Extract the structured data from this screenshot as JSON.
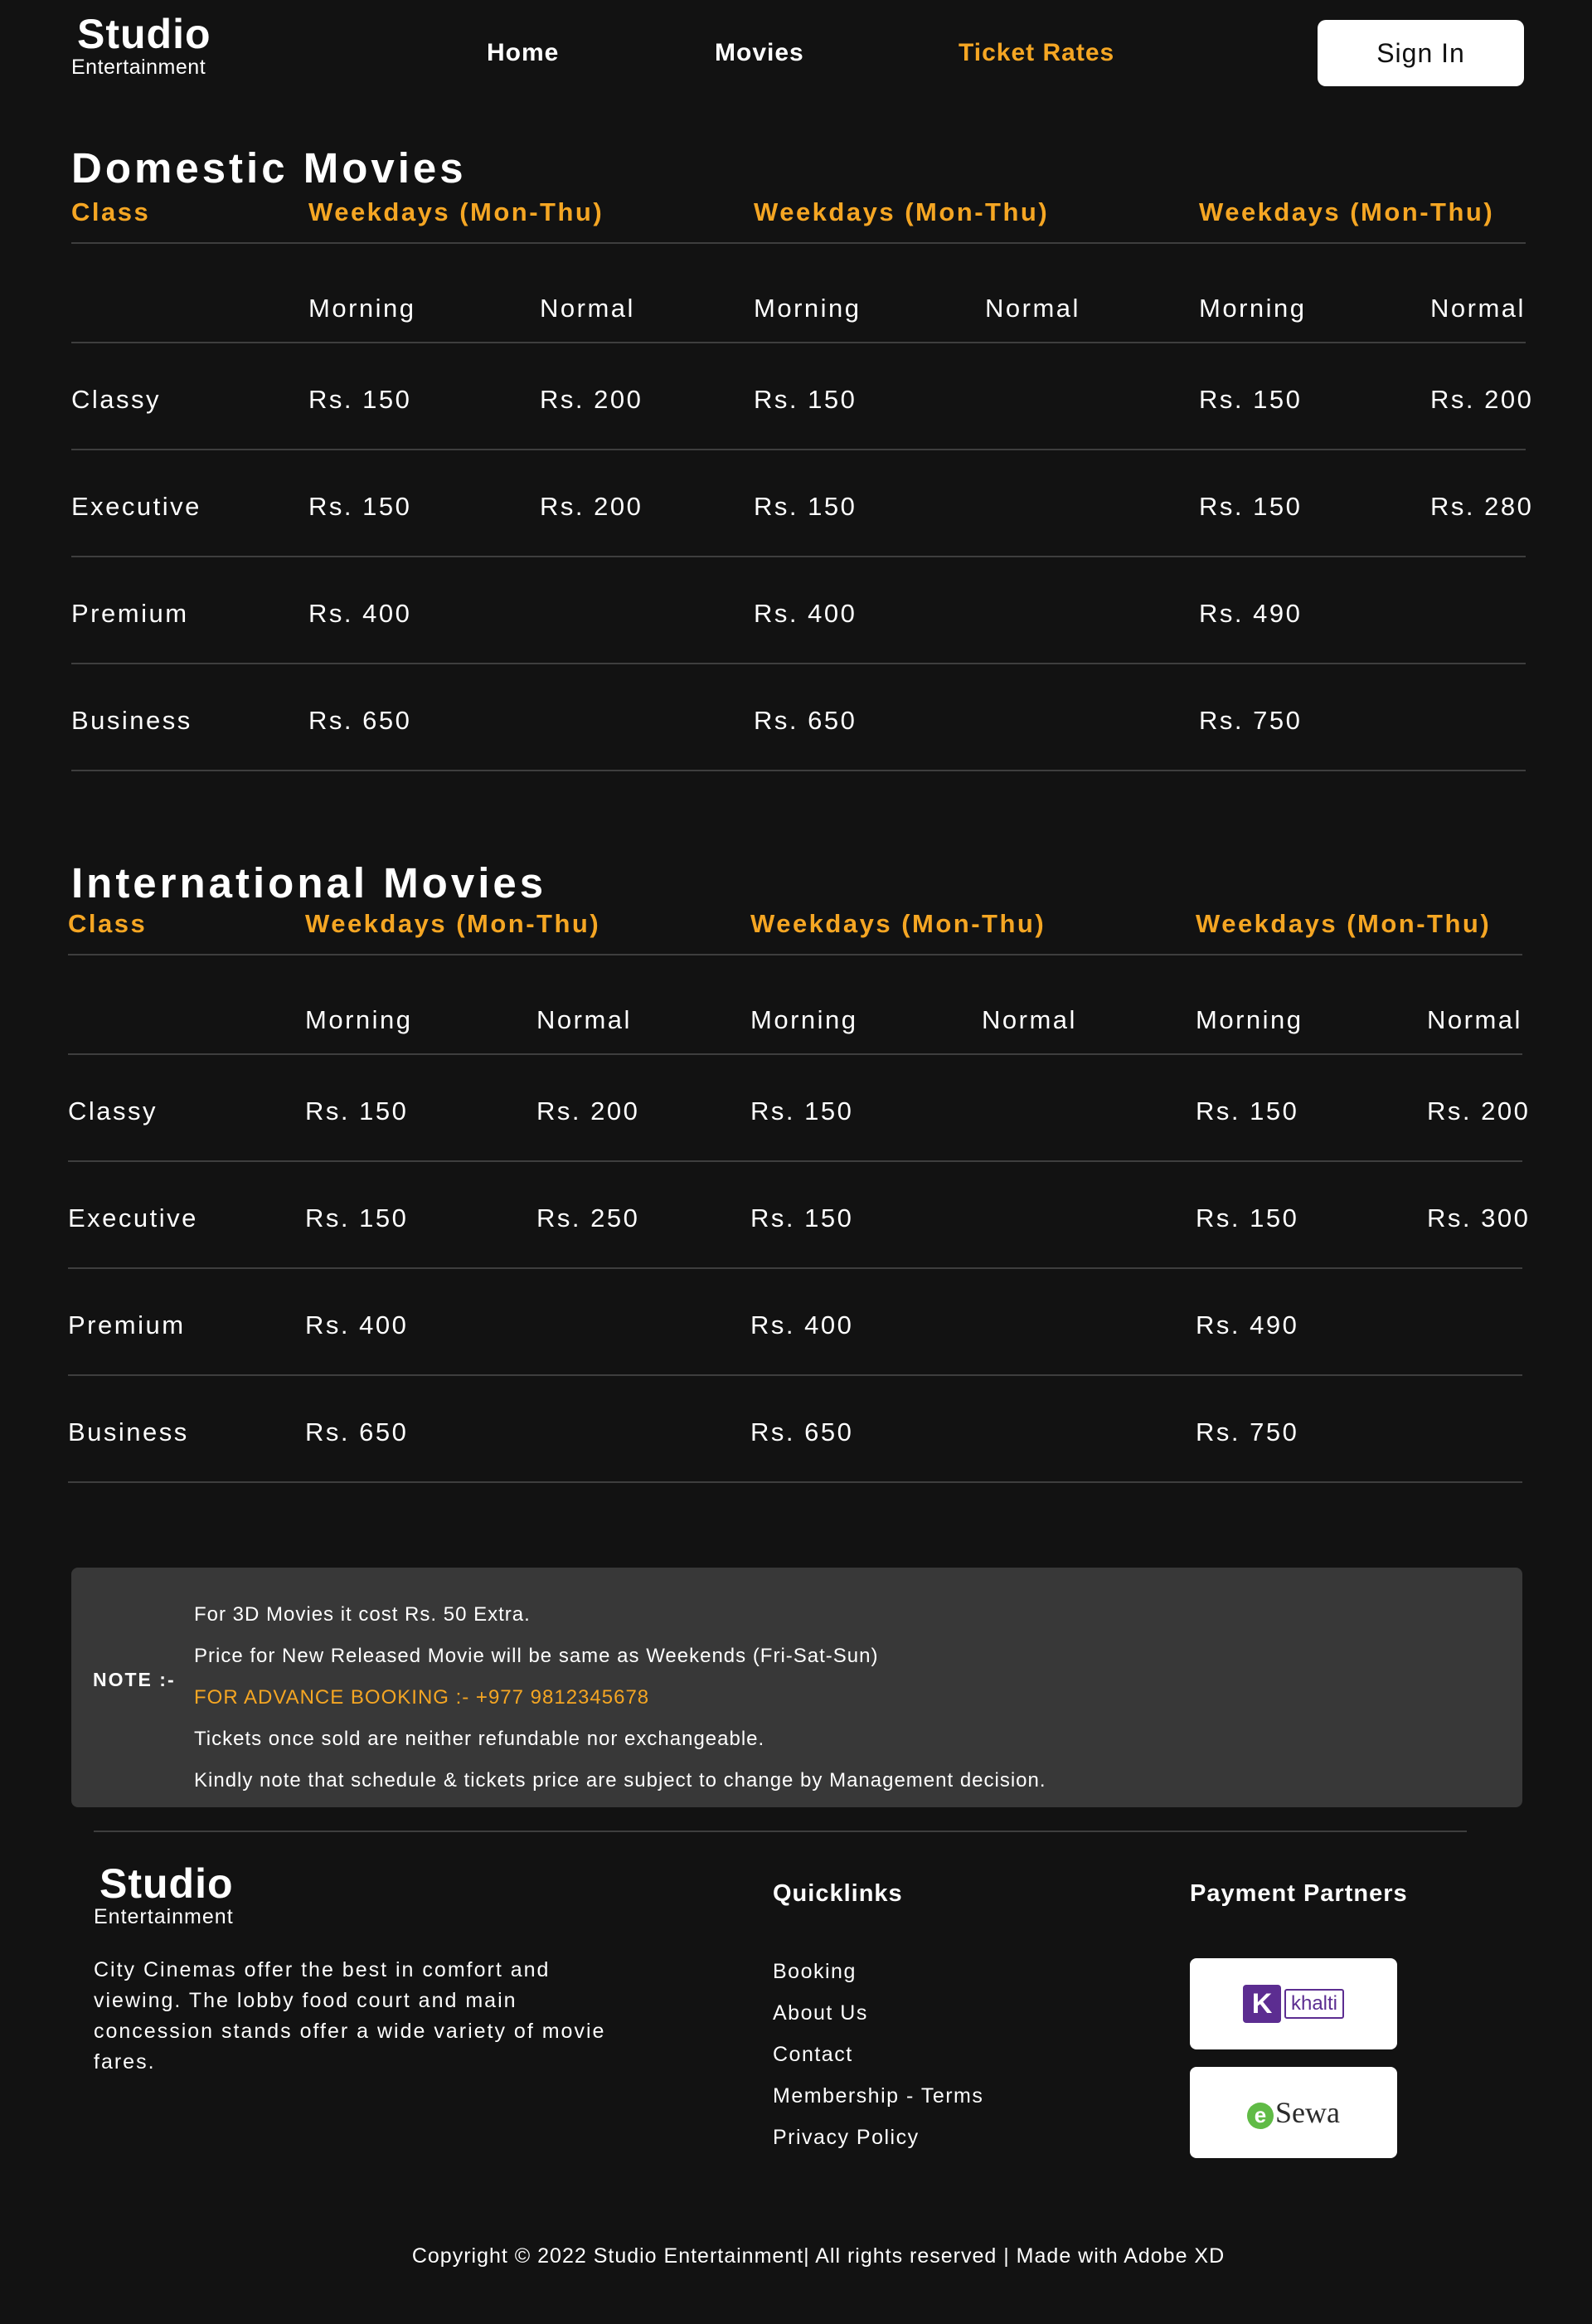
{
  "header": {
    "logo_title": "Studio",
    "logo_subtitle": "Entertainment",
    "nav": [
      {
        "label": "Home",
        "active": false
      },
      {
        "label": "Movies",
        "active": false
      },
      {
        "label": "Ticket Rates",
        "active": true
      }
    ],
    "signin_label": "Sign In"
  },
  "accent_color": "#F5A623",
  "domestic": {
    "title": "Domestic Movies",
    "headers": [
      "Class",
      "Weekdays (Mon-Thu)",
      "Weekdays (Mon-Thu)",
      "Weekdays (Mon-Thu)"
    ],
    "subheaders": [
      "Morning",
      "Normal",
      "Morning",
      "Normal",
      "Morning",
      "Normal"
    ],
    "rows": [
      {
        "class": "Classy",
        "values": [
          "Rs. 150",
          "Rs. 200",
          "Rs. 150",
          "",
          "Rs. 150",
          "Rs. 200"
        ]
      },
      {
        "class": "Executive",
        "values": [
          "Rs. 150",
          "Rs. 200",
          "Rs. 150",
          "",
          "Rs. 150",
          "Rs. 280"
        ]
      },
      {
        "class": "Premium",
        "values": [
          "Rs. 400",
          "",
          "Rs. 400",
          "",
          "Rs. 490",
          ""
        ]
      },
      {
        "class": "Business",
        "values": [
          "Rs. 650",
          "",
          "Rs. 650",
          "",
          "Rs. 750",
          ""
        ]
      }
    ]
  },
  "international": {
    "title": "International Movies",
    "headers": [
      "Class",
      "Weekdays (Mon-Thu)",
      "Weekdays (Mon-Thu)",
      "Weekdays (Mon-Thu)"
    ],
    "subheaders": [
      "Morning",
      "Normal",
      "Morning",
      "Normal",
      "Morning",
      "Normal"
    ],
    "rows": [
      {
        "class": "Classy",
        "values": [
          "Rs. 150",
          "Rs. 200",
          "Rs. 150",
          "",
          "Rs. 150",
          "Rs. 200"
        ]
      },
      {
        "class": "Executive",
        "values": [
          "Rs. 150",
          "Rs. 250",
          "Rs. 150",
          "",
          "Rs. 150",
          "Rs. 300"
        ]
      },
      {
        "class": "Premium",
        "values": [
          "Rs. 400",
          "",
          "Rs. 400",
          "",
          "Rs. 490",
          ""
        ]
      },
      {
        "class": "Business",
        "values": [
          "Rs. 650",
          "",
          "Rs. 650",
          "",
          "Rs. 750",
          ""
        ]
      }
    ]
  },
  "note": {
    "label": "NOTE :-",
    "lines": [
      {
        "text": "For 3D Movies it cost Rs. 50 Extra.",
        "highlight": false
      },
      {
        "text": "Price for New Released Movie will be same as Weekends (Fri-Sat-Sun)",
        "highlight": false
      },
      {
        "text": "FOR ADVANCE BOOKING :- +977 9812345678",
        "highlight": true
      },
      {
        "text": "Tickets once sold are neither refundable nor exchangeable.",
        "highlight": false
      },
      {
        "text": "Kindly note that schedule & tickets price are subject to change by Management decision.",
        "highlight": false
      }
    ]
  },
  "footer": {
    "logo_title": "Studio",
    "logo_subtitle": "Entertainment",
    "about": "City Cinemas offer the best in comfort and viewing. The lobby food court and main concession stands offer a wide variety of movie fares.",
    "quicklinks_title": "Quicklinks",
    "quicklinks": [
      "Booking",
      "About Us",
      "Contact",
      "Membership - Terms",
      "Privacy Policy"
    ],
    "partners_title": "Payment Partners",
    "partners": [
      {
        "name": "khalti",
        "icon": "khalti-logo",
        "mark": "K"
      },
      {
        "name": "Sewa",
        "icon": "esewa-logo",
        "mark": "e"
      }
    ],
    "copyright": "Copyright © 2022 Studio Entertainment| All rights reserved | Made with Adobe XD"
  }
}
